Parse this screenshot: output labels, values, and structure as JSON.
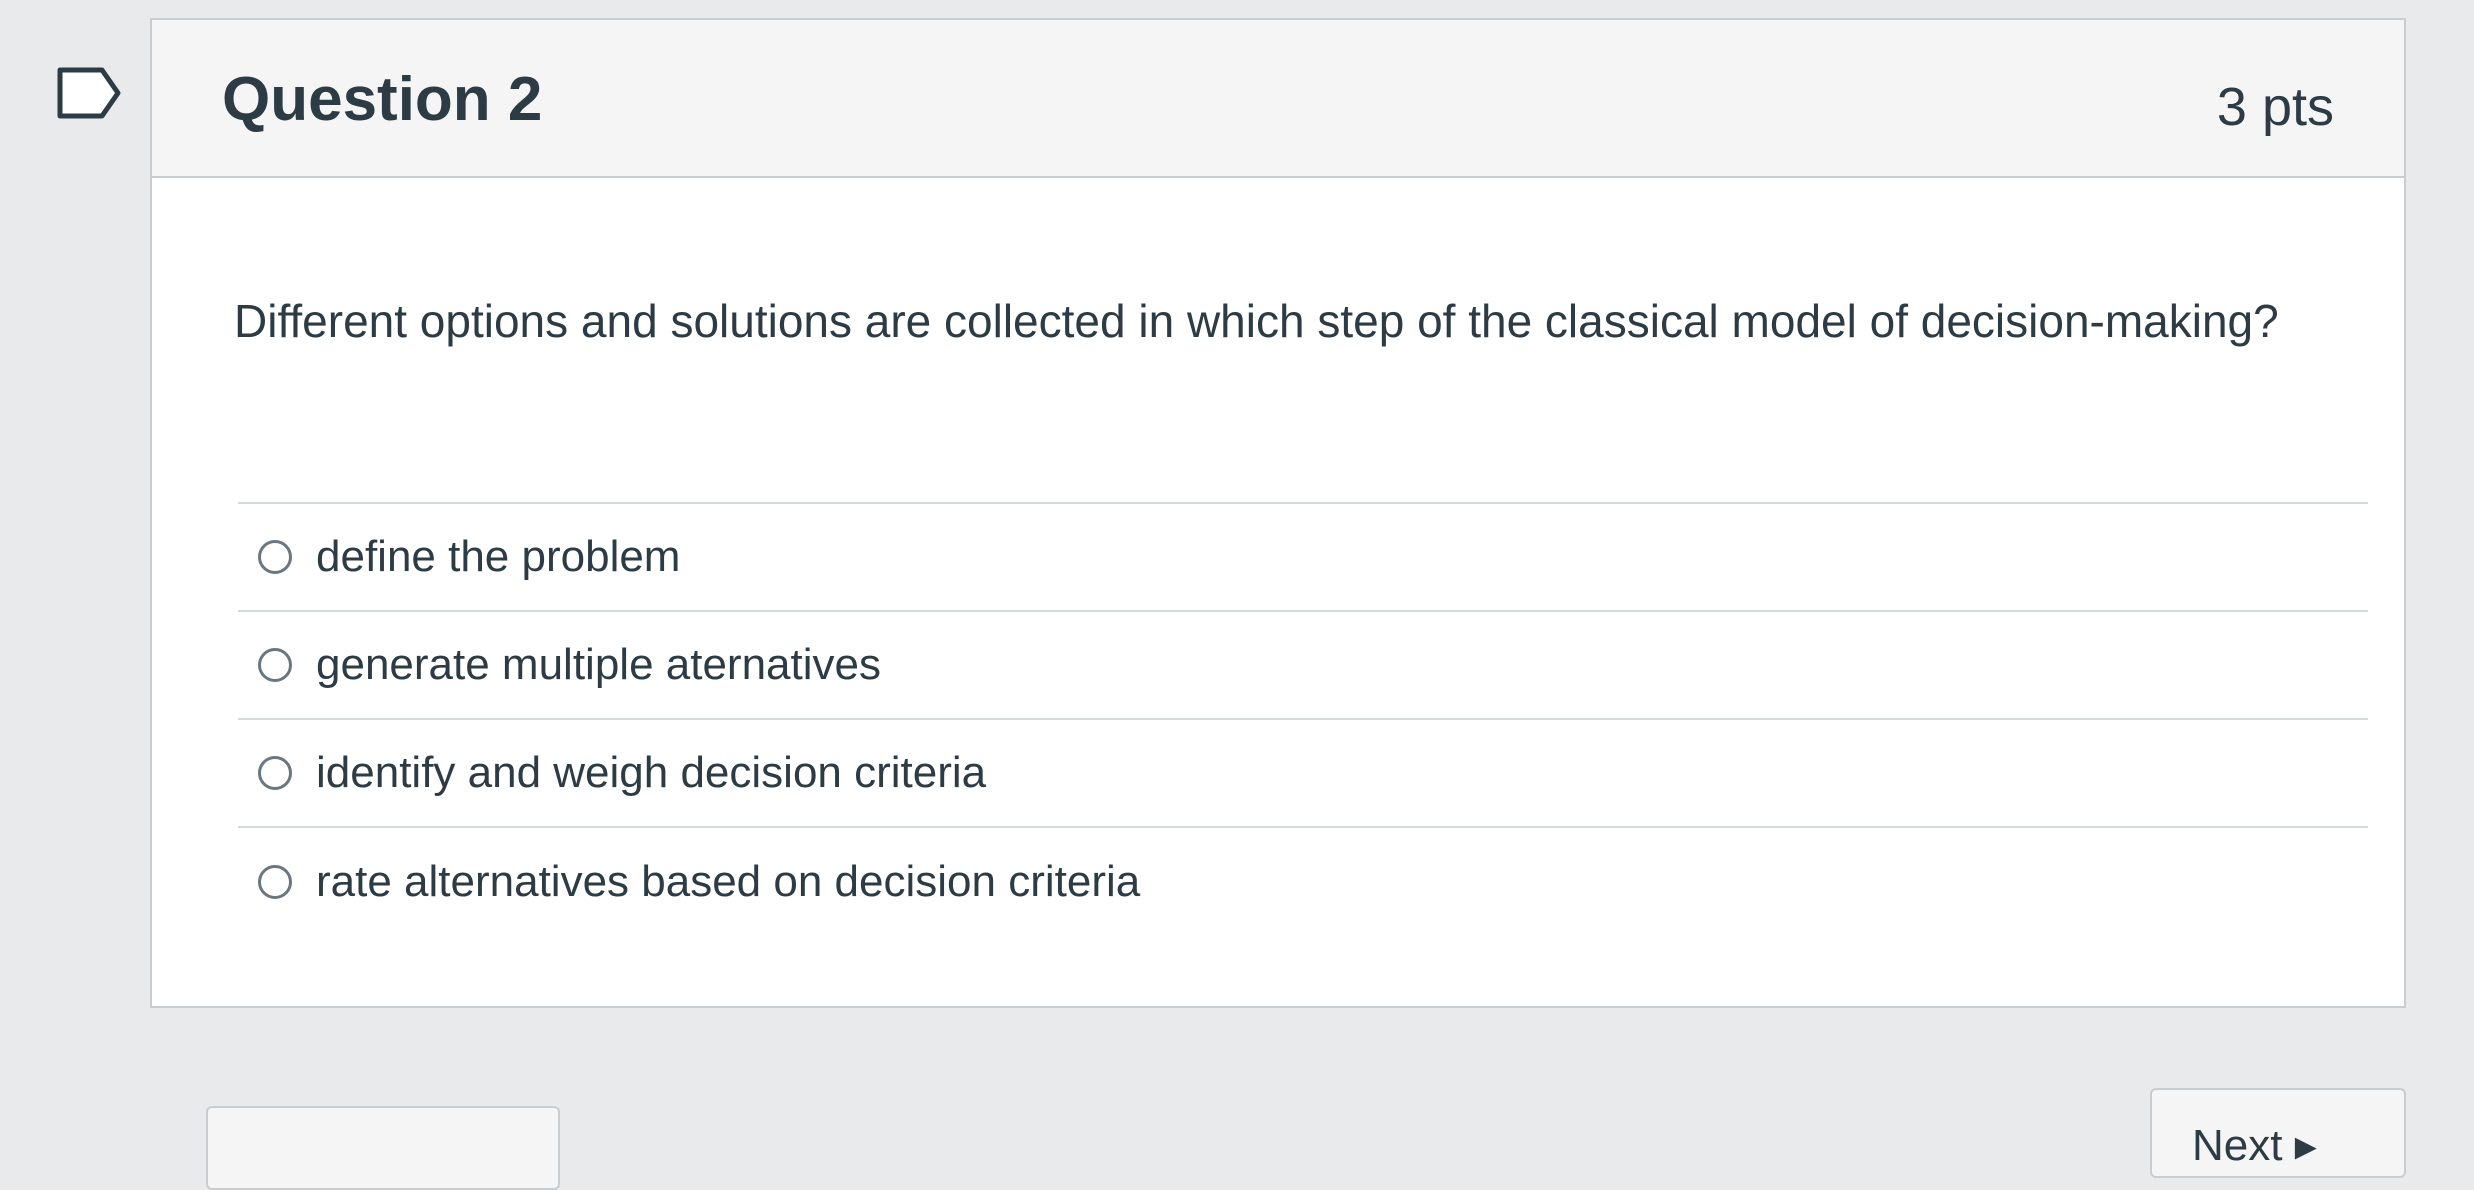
{
  "question": {
    "title": "Question 2",
    "points": "3 pts",
    "text": "Different options and solutions are collected in which step of the classical model of decision-making?",
    "answers": [
      {
        "label": "define the problem"
      },
      {
        "label": "generate multiple aternatives"
      },
      {
        "label": "identify and weigh decision criteria"
      },
      {
        "label": "rate alternatives based on decision criteria"
      }
    ]
  },
  "nav": {
    "previous_label": "",
    "next_label": "Next ▸"
  },
  "colors": {
    "text": "#2d3b45",
    "border": "#c7cdd1",
    "header_bg": "#f5f5f5"
  },
  "icons": {
    "flag": "flag-question-icon",
    "radio": "radio-unselected-icon"
  }
}
